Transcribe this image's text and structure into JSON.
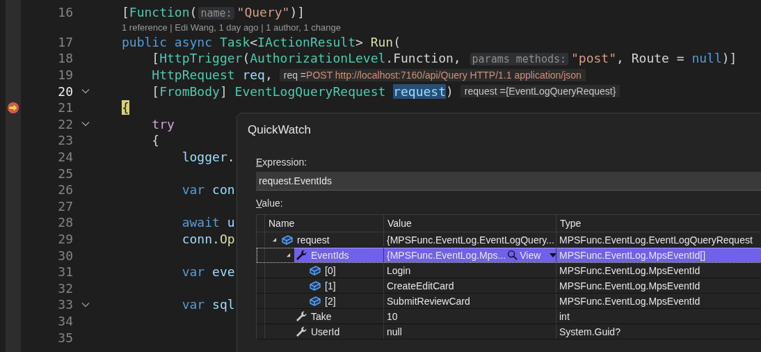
{
  "editor": {
    "lines": [
      {
        "kind": "code",
        "number": "16",
        "current": false,
        "foldable": false,
        "pointer": false,
        "tokens": [
          {
            "t": "[",
            "kind": "p"
          },
          {
            "t": "Function",
            "kind": "type"
          },
          {
            "t": "(",
            "kind": "p"
          },
          {
            "t": "name:",
            "kind": "hint"
          },
          {
            "t": "\"Query\"",
            "kind": "str"
          },
          {
            "t": ")]",
            "kind": "p"
          }
        ]
      },
      {
        "kind": "codelens",
        "text": "1 reference | Edi Wang, 1 day ago | 1 author, 1 change"
      },
      {
        "kind": "code",
        "number": "17",
        "current": false,
        "foldable": false,
        "pointer": false,
        "tokens": [
          {
            "t": "public async ",
            "kind": "kw"
          },
          {
            "t": "Task",
            "kind": "type"
          },
          {
            "t": "<",
            "kind": "p"
          },
          {
            "t": "IActionResult",
            "kind": "type"
          },
          {
            "t": "> ",
            "kind": "p"
          },
          {
            "t": "Run",
            "kind": "method"
          },
          {
            "t": "(",
            "kind": "p"
          }
        ]
      },
      {
        "kind": "code",
        "number": "18",
        "current": false,
        "foldable": false,
        "pointer": false,
        "tokens": [
          {
            "t": "    [",
            "kind": "p"
          },
          {
            "t": "HttpTrigger",
            "kind": "type"
          },
          {
            "t": "(",
            "kind": "p"
          },
          {
            "t": "AuthorizationLevel",
            "kind": "type"
          },
          {
            "t": ".Function, ",
            "kind": "p"
          },
          {
            "t": "params methods:",
            "kind": "hint"
          },
          {
            "t": "\"post\"",
            "kind": "str"
          },
          {
            "t": ", Route = ",
            "kind": "p"
          },
          {
            "t": "null",
            "kind": "kw"
          },
          {
            "t": ")]",
            "kind": "p"
          }
        ]
      },
      {
        "kind": "code",
        "number": "19",
        "current": false,
        "foldable": false,
        "pointer": false,
        "tokens": [
          {
            "t": "    HttpRequest ",
            "kind": "type"
          },
          {
            "t": "req",
            "kind": "param"
          },
          {
            "t": ",",
            "kind": "p"
          }
        ],
        "data_tip": {
          "name": "req =",
          "value": "POST http://localhost:7160/api/Query HTTP/1.1 application/json",
          "kind": "str"
        }
      },
      {
        "kind": "code",
        "number": "20",
        "current": true,
        "foldable": true,
        "pointer": false,
        "tokens": [
          {
            "t": "    [",
            "kind": "p"
          },
          {
            "t": "FromBody",
            "kind": "type"
          },
          {
            "t": "] ",
            "kind": "p"
          },
          {
            "t": "EventLogQueryRequest ",
            "kind": "type"
          },
          {
            "t": "request",
            "kind": "selected"
          },
          {
            "t": ")",
            "kind": "p"
          }
        ],
        "data_tip": {
          "name": "request =",
          "value": "{EventLogQueryRequest}",
          "kind": "plain"
        }
      },
      {
        "kind": "code",
        "number": "21",
        "current": false,
        "foldable": false,
        "pointer": true,
        "tokens": [
          {
            "t": "{",
            "kind": "brace"
          }
        ]
      },
      {
        "kind": "code",
        "number": "22",
        "current": false,
        "foldable": true,
        "pointer": false,
        "tokens": [
          {
            "t": "    try",
            "kind": "ctrl"
          }
        ]
      },
      {
        "kind": "code",
        "number": "23",
        "current": false,
        "foldable": false,
        "pointer": false,
        "tokens": [
          {
            "t": "    {",
            "kind": "p"
          }
        ]
      },
      {
        "kind": "code",
        "number": "24",
        "current": false,
        "foldable": false,
        "pointer": false,
        "tokens": [
          {
            "t": "        logger",
            "kind": "param"
          },
          {
            "t": ".",
            "kind": "p"
          }
        ]
      },
      {
        "kind": "code",
        "number": "25",
        "current": false,
        "foldable": false,
        "pointer": false
      },
      {
        "kind": "code",
        "number": "26",
        "current": false,
        "foldable": false,
        "pointer": false,
        "tokens": [
          {
            "t": "        var",
            "kind": "kw"
          },
          {
            "t": " con",
            "kind": "param"
          }
        ]
      },
      {
        "kind": "code",
        "number": "27",
        "current": false,
        "foldable": false,
        "pointer": false
      },
      {
        "kind": "code",
        "number": "28",
        "current": false,
        "foldable": false,
        "pointer": false,
        "tokens": [
          {
            "t": "        await",
            "kind": "kw"
          },
          {
            "t": " u",
            "kind": "param"
          }
        ]
      },
      {
        "kind": "code",
        "number": "29",
        "current": false,
        "foldable": false,
        "pointer": false,
        "tokens": [
          {
            "t": "        conn",
            "kind": "param"
          },
          {
            "t": ".",
            "kind": "p"
          },
          {
            "t": "Op",
            "kind": "method"
          }
        ]
      },
      {
        "kind": "code",
        "number": "30",
        "current": false,
        "foldable": false,
        "pointer": false
      },
      {
        "kind": "code",
        "number": "31",
        "current": false,
        "foldable": false,
        "pointer": false,
        "tokens": [
          {
            "t": "        var",
            "kind": "kw"
          },
          {
            "t": " eve",
            "kind": "param"
          }
        ]
      },
      {
        "kind": "code",
        "number": "32",
        "current": false,
        "foldable": false,
        "pointer": false
      },
      {
        "kind": "code",
        "number": "33",
        "current": false,
        "foldable": true,
        "pointer": false,
        "tokens": [
          {
            "t": "        var",
            "kind": "kw"
          },
          {
            "t": " sql",
            "kind": "param"
          }
        ]
      },
      {
        "kind": "code",
        "number": "34",
        "current": false,
        "foldable": false,
        "pointer": false
      },
      {
        "kind": "code",
        "number": "35",
        "current": false,
        "foldable": false,
        "pointer": false
      }
    ]
  },
  "quickwatch": {
    "title": "QuickWatch",
    "expression_label": "Expression:",
    "expression": "request.EventIds",
    "value_label": "Value:",
    "columns": [
      "Name",
      "Value",
      "Type"
    ],
    "rows": [
      {
        "name": "request",
        "value": "{MPSFunc.EventLog.EventLogQuery...",
        "type": "MPSFunc.EventLog.EventLogQueryRequest",
        "kind": "object",
        "expanded": true,
        "selected": false,
        "children": [
          {
            "name": "EventIds",
            "value": "{MPSFunc.EventLog.Mps...",
            "visualizer": "View",
            "type": "MPSFunc.EventLog.MpsEventId[]",
            "kind": "property",
            "expanded": true,
            "selected": true,
            "children": [
              {
                "name": "[0]",
                "value": "Login",
                "type": "MPSFunc.EventLog.MpsEventId",
                "kind": "object",
                "selected": false
              },
              {
                "name": "[1]",
                "value": "CreateEditCard",
                "type": "MPSFunc.EventLog.MpsEventId",
                "kind": "object",
                "selected": false
              },
              {
                "name": "[2]",
                "value": "SubmitReviewCard",
                "type": "MPSFunc.EventLog.MpsEventId",
                "kind": "object",
                "selected": false
              }
            ]
          },
          {
            "name": "Take",
            "value": "10",
            "type": "int",
            "kind": "property",
            "selected": false
          },
          {
            "name": "UserId",
            "value": "null",
            "type": "System.Guid?",
            "kind": "property",
            "selected": false
          }
        ]
      }
    ]
  }
}
